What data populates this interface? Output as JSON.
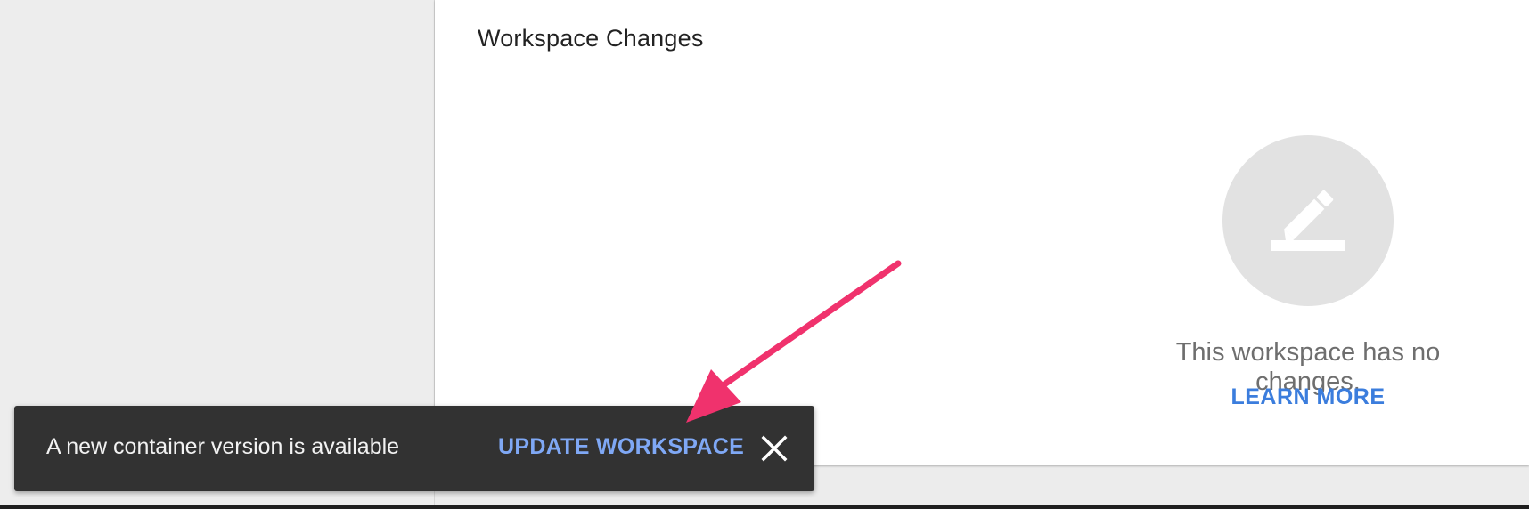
{
  "workspace_card": {
    "title": "Workspace Changes",
    "empty_message": "This workspace has no changes.",
    "learn_more_label": "LEARN MORE",
    "empty_icon": "edit-pencil-icon"
  },
  "snackbar": {
    "message": "A new container version is available",
    "action_label": "UPDATE WORKSPACE",
    "close_icon": "close-icon"
  },
  "annotation": {
    "type": "arrow",
    "color": "#f0326d",
    "points_to": "UPDATE WORKSPACE"
  },
  "colors": {
    "accent": "#3b7ddd",
    "snackbar_bg": "#323232",
    "snackbar_action": "#7fa8f5",
    "empty_icon_bg": "#e2e2e2",
    "page_bg": "#ececec"
  }
}
